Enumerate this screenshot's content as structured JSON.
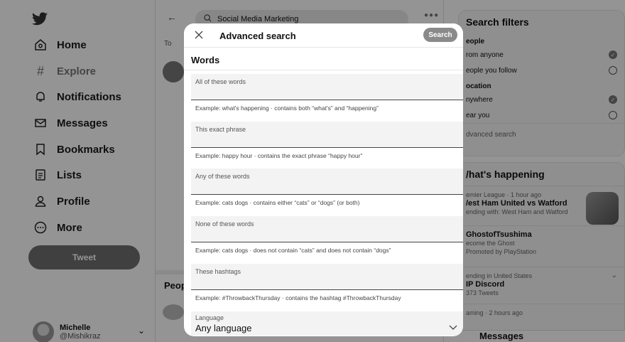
{
  "sidebar": {
    "items": [
      {
        "label": "Home",
        "icon": "home-icon"
      },
      {
        "label": "Explore",
        "icon": "hashtag-icon"
      },
      {
        "label": "Notifications",
        "icon": "bell-icon"
      },
      {
        "label": "Messages",
        "icon": "envelope-icon"
      },
      {
        "label": "Bookmarks",
        "icon": "bookmark-icon"
      },
      {
        "label": "Lists",
        "icon": "list-icon"
      },
      {
        "label": "Profile",
        "icon": "person-icon"
      },
      {
        "label": "More",
        "icon": "more-circle-icon"
      }
    ],
    "tweet_label": "Tweet",
    "user": {
      "name": "Michelle",
      "handle": "@Mishikraz"
    }
  },
  "center": {
    "search_query": "Social Media Marketing",
    "tab_partial": "To",
    "people_header": "Peop"
  },
  "right": {
    "filters_title": "Search filters",
    "people_title": "eople",
    "from_anyone": "rom anyone",
    "people_follow": "eople you follow",
    "location_title": "ocation",
    "anywhere": "nywhere",
    "near_you": "ear you",
    "advanced_link": "dvanced search",
    "happening_title": "/hat's happening",
    "trends": [
      {
        "meta": "emier League · 1 hour ago",
        "title": "/est Ham United vs Watford",
        "sub": "ending with: West Ham and Watford"
      },
      {
        "meta": "",
        "title": "GhostofTsushima",
        "sub": "ecome the Ghost",
        "extra": "Promoted by PlayStation"
      },
      {
        "meta": "ending in United States",
        "title": "IP Discord",
        "sub": "373 Tweets"
      },
      {
        "meta": "aming · 2 hours ago",
        "title": "",
        "sub": ""
      }
    ],
    "messages_label": "Messages"
  },
  "modal": {
    "title": "Advanced search",
    "search_button": "Search",
    "section_title": "Words",
    "fields": [
      {
        "label": "All of these words",
        "hint": "Example: what's happening · contains both “what's” and “happening”"
      },
      {
        "label": "This exact phrase",
        "hint": "Example: happy hour · contains the exact phrase “happy hour”"
      },
      {
        "label": "Any of these words",
        "hint": "Example: cats dogs · contains either “cats” or “dogs” (or both)"
      },
      {
        "label": "None of these words",
        "hint": "Example: cats dogs · does not contain “cats” and does not contain “dogs”"
      },
      {
        "label": "These hashtags",
        "hint": "Example: #ThrowbackThursday · contains the hashtag #ThrowbackThursday"
      }
    ],
    "language_label": "Language",
    "language_value": "Any language"
  }
}
